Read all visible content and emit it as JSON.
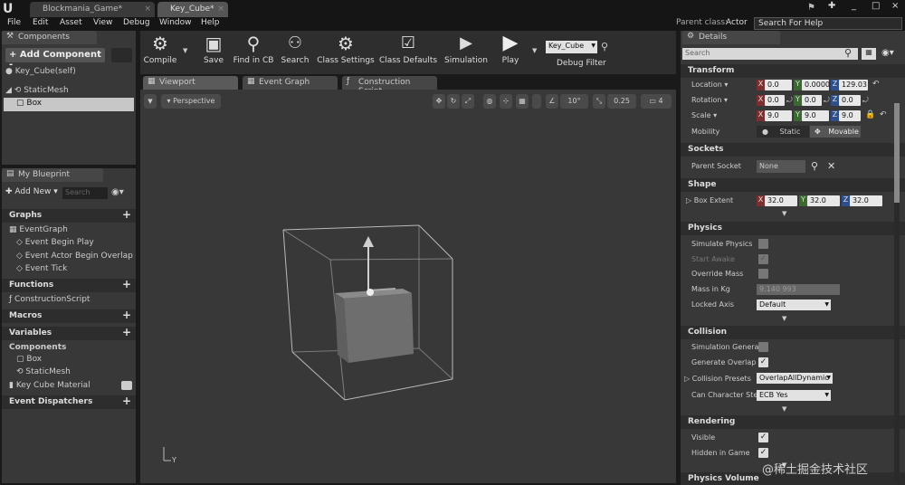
{
  "tabs": [
    {
      "label": "Blockmania_Game*",
      "active": false
    },
    {
      "label": "Key_Cube*",
      "active": true
    }
  ],
  "parent_class": {
    "label": "Parent class:",
    "value": "Actor"
  },
  "help_search_placeholder": "Search For Help",
  "menu": [
    "File",
    "Edit",
    "Asset",
    "View",
    "Debug",
    "Window",
    "Help"
  ],
  "components": {
    "header": "Components",
    "add_button": "+ Add Component -",
    "self": "Key_Cube(self)",
    "static_mesh": "StaticMesh",
    "box": "Box"
  },
  "my_blueprint": {
    "header": "My Blueprint",
    "add_new": "Add New",
    "search_placeholder": "Search",
    "graphs": "Graphs",
    "event_graph": "EventGraph",
    "events": [
      "Event Begin Play",
      "Event Actor Begin Overlap",
      "Event Tick"
    ],
    "functions": "Functions",
    "construction_script": "ConstructionScript",
    "macros": "Macros",
    "variables": "Variables",
    "components_cat": "Components",
    "comp_box": "Box",
    "comp_mesh": "StaticMesh",
    "key_cube_material": "Key Cube Material",
    "event_dispatchers": "Event Dispatchers"
  },
  "toolbar": {
    "compile": "Compile",
    "save": "Save",
    "find_in_cb": "Find in CB",
    "search": "Search",
    "class_settings": "Class Settings",
    "class_defaults": "Class Defaults",
    "simulation": "Simulation",
    "play": "Play",
    "debug_object": "Key_Cube",
    "debug_filter": "Debug Filter"
  },
  "editor_tabs": [
    "Viewport",
    "Event Graph",
    "Construction Script"
  ],
  "viewport": {
    "view_mode": "Perspective",
    "grid_snap": "10°",
    "scale_snap": "0.25",
    "cam_speed": "4",
    "axis_label": "Y"
  },
  "details": {
    "header": "Details",
    "search_placeholder": "Search",
    "transform": "Transform",
    "location_label": "Location",
    "location": [
      "0.0",
      "0.0000",
      "129.03"
    ],
    "rotation_label": "Rotation",
    "rotation": [
      "0.0",
      "0.0",
      "0.0"
    ],
    "scale_label": "Scale",
    "scale": [
      "9.0",
      "9.0",
      "9.0"
    ],
    "mobility_label": "Mobility",
    "mobility_static": "Static",
    "mobility_movable": "Movable",
    "sockets": "Sockets",
    "parent_socket_label": "Parent Socket",
    "parent_socket_value": "None",
    "shape": "Shape",
    "box_extent_label": "Box Extent",
    "box_extent": [
      "32.0",
      "32.0",
      "32.0"
    ],
    "physics": "Physics",
    "simulate_physics": "Simulate Physics",
    "start_awake": "Start Awake",
    "override_mass": "Override Mass",
    "mass_in_kg_label": "Mass in Kg",
    "mass_in_kg_value": "9.140 993",
    "locked_axis_label": "Locked Axis",
    "locked_axis_value": "Default",
    "collision": "Collision",
    "simulation_generates": "Simulation Genera",
    "generate_overlap": "Generate Overlap E",
    "collision_presets_label": "Collision Presets",
    "collision_presets_value": "OverlapAllDynamic",
    "can_character_step_label": "Can Character Step",
    "can_character_step_value": "ECB Yes",
    "rendering": "Rendering",
    "visible": "Visible",
    "hidden_in_game": "Hidden in Game",
    "physics_volume": "Physics Volume"
  },
  "watermark": "@稀土掘金技术社区"
}
